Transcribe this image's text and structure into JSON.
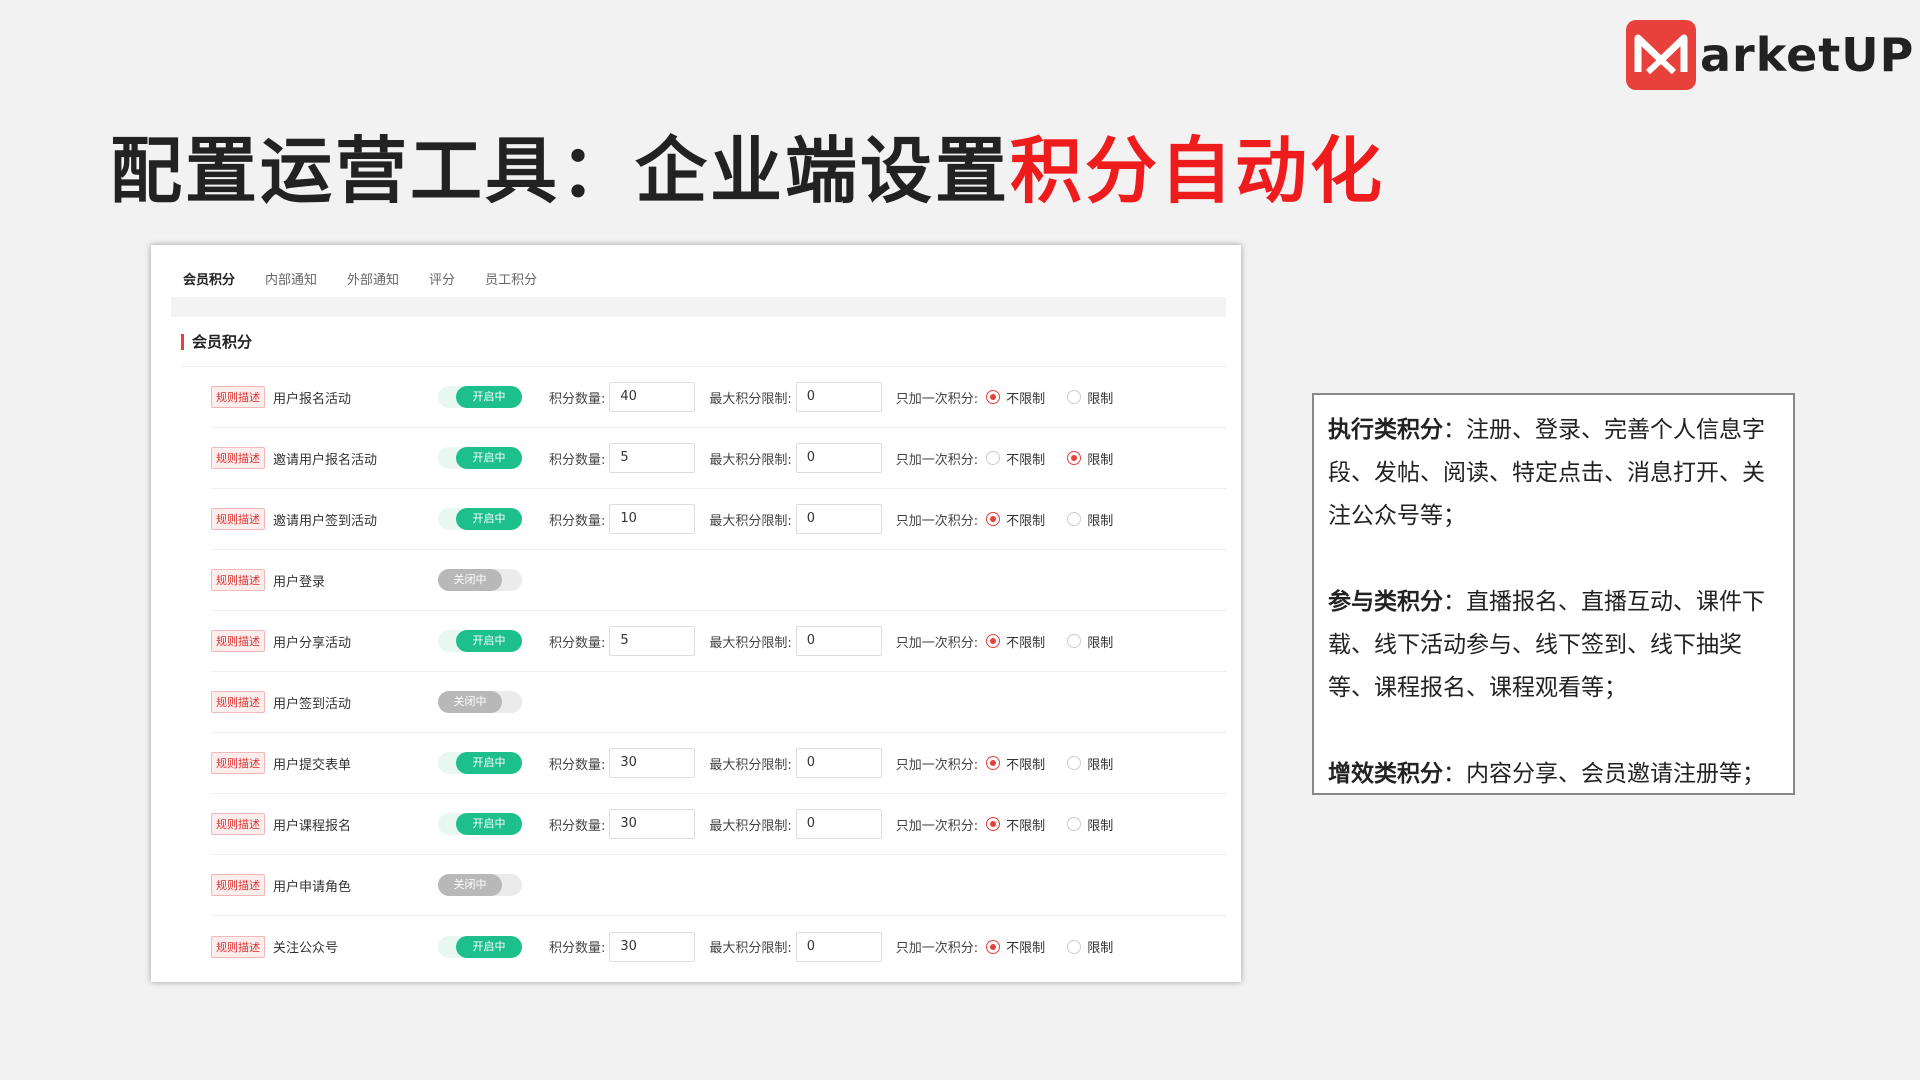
{
  "logo": {
    "text": "arketUP"
  },
  "headline": {
    "black": "配置运营工具：企业端设置",
    "red": "积分自动化"
  },
  "tabs": [
    {
      "label": "会员积分",
      "active": true
    },
    {
      "label": "内部通知",
      "active": false
    },
    {
      "label": "外部通知",
      "active": false
    },
    {
      "label": "评分",
      "active": false
    },
    {
      "label": "员工积分",
      "active": false
    }
  ],
  "section": {
    "title": "会员积分"
  },
  "labels": {
    "rule_tag": "规则描述",
    "points_qty": "积分数量:",
    "max_limit": "最大积分限制:",
    "once_only": "只加一次积分:",
    "unlimited": "不限制",
    "limited": "限制",
    "on": "开启中",
    "off": "关闭中"
  },
  "rows": [
    {
      "name": "用户报名活动",
      "enabled": true,
      "points": "40",
      "max": "0",
      "once": "unlimited"
    },
    {
      "name": "邀请用户报名活动",
      "enabled": true,
      "points": "5",
      "max": "0",
      "once": "limited"
    },
    {
      "name": "邀请用户签到活动",
      "enabled": true,
      "points": "10",
      "max": "0",
      "once": "unlimited"
    },
    {
      "name": "用户登录",
      "enabled": false
    },
    {
      "name": "用户分享活动",
      "enabled": true,
      "points": "5",
      "max": "0",
      "once": "unlimited"
    },
    {
      "name": "用户签到活动",
      "enabled": false
    },
    {
      "name": "用户提交表单",
      "enabled": true,
      "points": "30",
      "max": "0",
      "once": "unlimited"
    },
    {
      "name": "用户课程报名",
      "enabled": true,
      "points": "30",
      "max": "0",
      "once": "unlimited"
    },
    {
      "name": "用户申请角色",
      "enabled": false
    },
    {
      "name": "关注公众号",
      "enabled": true,
      "points": "30",
      "max": "0",
      "once": "unlimited"
    }
  ],
  "info": {
    "exec_title": "执行类积分",
    "exec_text": "：注册、登录、完善个人信息字段、发帖、阅读、特定点击、消息打开、关注公众号等；",
    "participate_title": "参与类积分",
    "participate_text": "：直播报名、直播互动、课件下载、线下活动参与、线下签到、线下抽奖等、课程报名、课程观看等；",
    "boost_title": "增效类积分",
    "boost_text": "：内容分享、会员邀请注册等；"
  },
  "colors": {
    "accent": "#e8403a",
    "toggle_on": "#1dbf8b",
    "toggle_off": "#b8b8b8",
    "headline_red": "#ee1c1c"
  }
}
